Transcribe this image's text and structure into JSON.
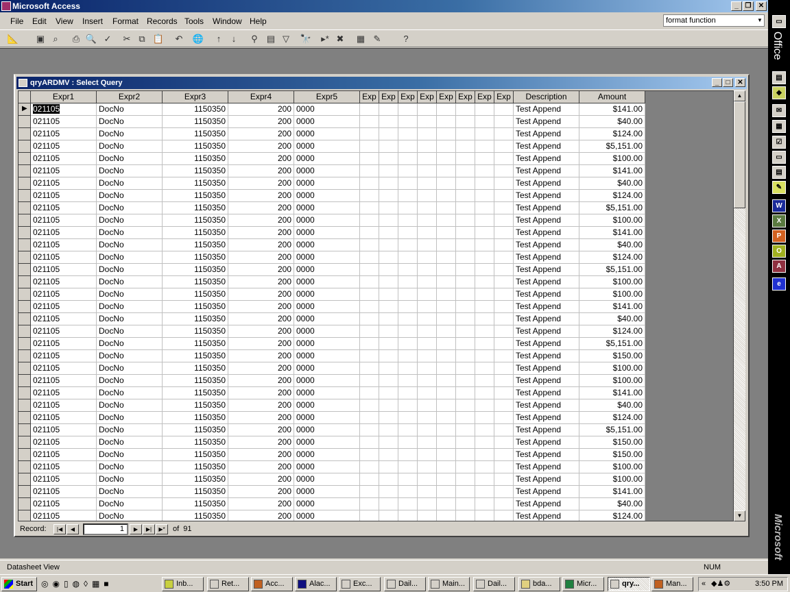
{
  "app": {
    "title": "Microsoft Access"
  },
  "menu": [
    "File",
    "Edit",
    "View",
    "Insert",
    "Format",
    "Records",
    "Tools",
    "Window",
    "Help"
  ],
  "ask_box": {
    "value": "format function"
  },
  "child": {
    "title": "qryARDMV : Select Query"
  },
  "columns": [
    "Expr1",
    "Expr2",
    "Expr3",
    "Expr4",
    "Expr5",
    "Exp",
    "Exp",
    "Exp",
    "Exp",
    "Exp",
    "Exp",
    "Exp",
    "Exp",
    "Description",
    "Amount"
  ],
  "rows": [
    [
      "021105",
      "DocNo",
      "1150350",
      "200",
      "0000",
      "Test Append",
      "$141.00"
    ],
    [
      "021105",
      "DocNo",
      "1150350",
      "200",
      "0000",
      "Test Append",
      "$40.00"
    ],
    [
      "021105",
      "DocNo",
      "1150350",
      "200",
      "0000",
      "Test Append",
      "$124.00"
    ],
    [
      "021105",
      "DocNo",
      "1150350",
      "200",
      "0000",
      "Test Append",
      "$5,151.00"
    ],
    [
      "021105",
      "DocNo",
      "1150350",
      "200",
      "0000",
      "Test Append",
      "$100.00"
    ],
    [
      "021105",
      "DocNo",
      "1150350",
      "200",
      "0000",
      "Test Append",
      "$141.00"
    ],
    [
      "021105",
      "DocNo",
      "1150350",
      "200",
      "0000",
      "Test Append",
      "$40.00"
    ],
    [
      "021105",
      "DocNo",
      "1150350",
      "200",
      "0000",
      "Test Append",
      "$124.00"
    ],
    [
      "021105",
      "DocNo",
      "1150350",
      "200",
      "0000",
      "Test Append",
      "$5,151.00"
    ],
    [
      "021105",
      "DocNo",
      "1150350",
      "200",
      "0000",
      "Test Append",
      "$100.00"
    ],
    [
      "021105",
      "DocNo",
      "1150350",
      "200",
      "0000",
      "Test Append",
      "$141.00"
    ],
    [
      "021105",
      "DocNo",
      "1150350",
      "200",
      "0000",
      "Test Append",
      "$40.00"
    ],
    [
      "021105",
      "DocNo",
      "1150350",
      "200",
      "0000",
      "Test Append",
      "$124.00"
    ],
    [
      "021105",
      "DocNo",
      "1150350",
      "200",
      "0000",
      "Test Append",
      "$5,151.00"
    ],
    [
      "021105",
      "DocNo",
      "1150350",
      "200",
      "0000",
      "Test Append",
      "$100.00"
    ],
    [
      "021105",
      "DocNo",
      "1150350",
      "200",
      "0000",
      "Test Append",
      "$100.00"
    ],
    [
      "021105",
      "DocNo",
      "1150350",
      "200",
      "0000",
      "Test Append",
      "$141.00"
    ],
    [
      "021105",
      "DocNo",
      "1150350",
      "200",
      "0000",
      "Test Append",
      "$40.00"
    ],
    [
      "021105",
      "DocNo",
      "1150350",
      "200",
      "0000",
      "Test Append",
      "$124.00"
    ],
    [
      "021105",
      "DocNo",
      "1150350",
      "200",
      "0000",
      "Test Append",
      "$5,151.00"
    ],
    [
      "021105",
      "DocNo",
      "1150350",
      "200",
      "0000",
      "Test Append",
      "$150.00"
    ],
    [
      "021105",
      "DocNo",
      "1150350",
      "200",
      "0000",
      "Test Append",
      "$100.00"
    ],
    [
      "021105",
      "DocNo",
      "1150350",
      "200",
      "0000",
      "Test Append",
      "$100.00"
    ],
    [
      "021105",
      "DocNo",
      "1150350",
      "200",
      "0000",
      "Test Append",
      "$141.00"
    ],
    [
      "021105",
      "DocNo",
      "1150350",
      "200",
      "0000",
      "Test Append",
      "$40.00"
    ],
    [
      "021105",
      "DocNo",
      "1150350",
      "200",
      "0000",
      "Test Append",
      "$124.00"
    ],
    [
      "021105",
      "DocNo",
      "1150350",
      "200",
      "0000",
      "Test Append",
      "$5,151.00"
    ],
    [
      "021105",
      "DocNo",
      "1150350",
      "200",
      "0000",
      "Test Append",
      "$150.00"
    ],
    [
      "021105",
      "DocNo",
      "1150350",
      "200",
      "0000",
      "Test Append",
      "$150.00"
    ],
    [
      "021105",
      "DocNo",
      "1150350",
      "200",
      "0000",
      "Test Append",
      "$100.00"
    ],
    [
      "021105",
      "DocNo",
      "1150350",
      "200",
      "0000",
      "Test Append",
      "$100.00"
    ],
    [
      "021105",
      "DocNo",
      "1150350",
      "200",
      "0000",
      "Test Append",
      "$141.00"
    ],
    [
      "021105",
      "DocNo",
      "1150350",
      "200",
      "0000",
      "Test Append",
      "$40.00"
    ],
    [
      "021105",
      "DocNo",
      "1150350",
      "200",
      "0000",
      "Test Append",
      "$124.00"
    ]
  ],
  "nav": {
    "label": "Record:",
    "current": "1",
    "of": "of  91"
  },
  "status": {
    "view": "Datasheet View",
    "num": "NUM"
  },
  "officebar": {
    "label": "Office",
    "brand": "Microsoft"
  },
  "taskbar": {
    "start": "Start",
    "tasks": [
      "Inb...",
      "Ret...",
      "Acc...",
      "Alac...",
      "Exc...",
      "Dail...",
      "Main...",
      "Dail...",
      "bda...",
      "Micr...",
      "qry...",
      "Man..."
    ],
    "active": 10,
    "clock": "3:50 PM"
  }
}
